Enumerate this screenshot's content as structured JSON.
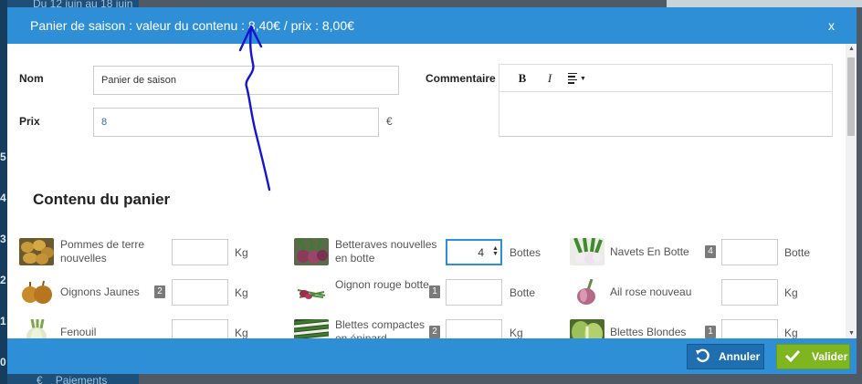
{
  "background": {
    "date_text": "Du 12 juin au 18 juin",
    "payments_label": "Paiements",
    "payments_icon": "euro-icon",
    "sidebar_numbers": [
      "5",
      "4",
      "3",
      "2",
      "1",
      "0"
    ]
  },
  "modal": {
    "title": "Panier de saison : valeur du contenu : 8,40€ / prix : 8,00€",
    "close_label": "x",
    "form": {
      "name_label": "Nom",
      "name_value": "Panier de saison",
      "price_label": "Prix",
      "price_value": "8",
      "currency": "€",
      "comment_label": "Commentaire",
      "editor_buttons": {
        "bold": "B",
        "italic": "I"
      }
    },
    "section_title": "Contenu du panier",
    "products": [
      {
        "name": "Pommes de terre nouvelles",
        "badge": "",
        "qty": "",
        "unit": "Kg",
        "icon": "potato-icon"
      },
      {
        "name": "Betteraves nouvelles en botte",
        "badge": "",
        "qty": "4",
        "unit": "Bottes",
        "icon": "beetroot-icon"
      },
      {
        "name": "Navets En Botte",
        "badge": "4",
        "qty": "",
        "unit": "Botte",
        "icon": "turnip-icon"
      },
      {
        "name": "Oignons Jaunes",
        "badge": "2",
        "qty": "",
        "unit": "Kg",
        "icon": "onion-icon"
      },
      {
        "name": "Oignon rouge botte",
        "badge": "1",
        "qty": "",
        "unit": "Botte",
        "icon": "red-onion-icon"
      },
      {
        "name": "Ail rose nouveau",
        "badge": "",
        "qty": "",
        "unit": "Kg",
        "icon": "garlic-icon"
      },
      {
        "name": "Fenouil",
        "badge": "",
        "qty": "",
        "unit": "Kg",
        "icon": "fennel-icon"
      },
      {
        "name": "Blettes compactes en épinard",
        "badge": "2",
        "qty": "",
        "unit": "Kg",
        "icon": "chard-icon"
      },
      {
        "name": "Blettes Blondes",
        "badge": "1",
        "qty": "",
        "unit": "Kg",
        "icon": "blond-chard-icon"
      }
    ],
    "footer": {
      "cancel_label": "Annuler",
      "validate_label": "Valider"
    }
  },
  "colors": {
    "header_blue": "#2f8fd6",
    "cancel_blue": "#1f6fb0",
    "validate_green": "#7fb61f",
    "annotation_ink": "#1414d2"
  }
}
